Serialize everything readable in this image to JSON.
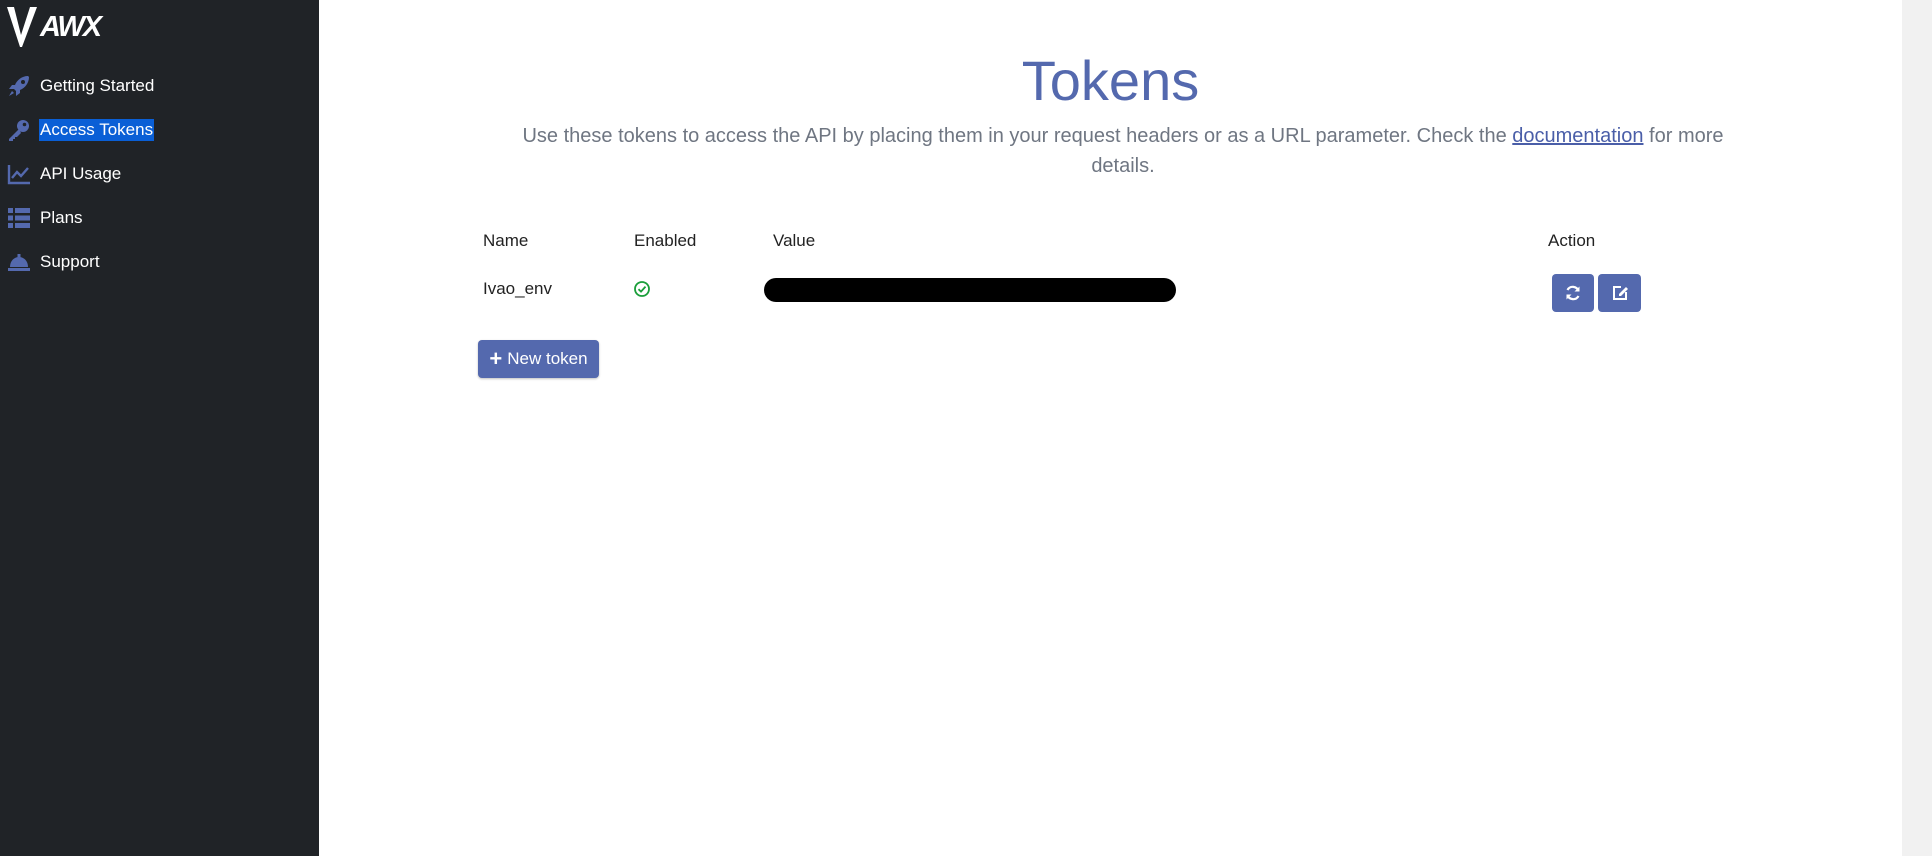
{
  "brand": {
    "logo_text": "AWX"
  },
  "sidebar": {
    "items": [
      {
        "label": "Getting Started",
        "icon": "rocket-icon"
      },
      {
        "label": "Access Tokens",
        "icon": "key-icon",
        "active": true
      },
      {
        "label": "API Usage",
        "icon": "line-chart-icon"
      },
      {
        "label": "Plans",
        "icon": "list-icon"
      },
      {
        "label": "Support",
        "icon": "bell-icon"
      }
    ]
  },
  "page": {
    "title": "Tokens",
    "subtitle_before": "Use these tokens to access the API by placing them in your request headers or as a URL parameter. Check the ",
    "subtitle_link": "documentation",
    "subtitle_after": " for more details."
  },
  "table": {
    "headers": {
      "name": "Name",
      "enabled": "Enabled",
      "value": "Value",
      "action": "Action"
    },
    "rows": [
      {
        "name": "Ivao_env",
        "enabled": true
      }
    ]
  },
  "buttons": {
    "new_token": "New token"
  },
  "colors": {
    "sidebar_bg": "#202327",
    "accent": "#5469ae",
    "active_highlight": "#0a5fd6",
    "success": "#1a9e3a"
  }
}
